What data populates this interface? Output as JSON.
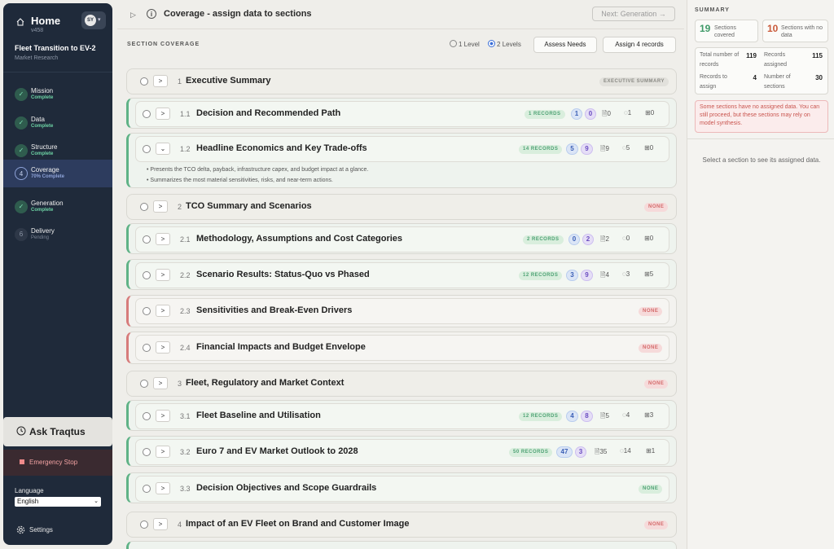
{
  "sidebar": {
    "home_title": "Home",
    "version": "v458",
    "avatar": "SY",
    "project_name": "Fleet Transition to EV-2",
    "project_sub": "Market Research",
    "steps": [
      {
        "label": "Mission",
        "status": "Complete"
      },
      {
        "label": "Data",
        "status": "Complete"
      },
      {
        "label": "Structure",
        "status": "Complete"
      },
      {
        "label": "Coverage",
        "status": "70% Complete",
        "num": "4"
      },
      {
        "label": "Generation",
        "status": "Complete"
      },
      {
        "label": "Delivery",
        "status": "Pending",
        "num": "6"
      }
    ],
    "ask_label": "Ask Traqtus",
    "emergency_label": "Emergency Stop",
    "language_label": "Language",
    "language_value": "English",
    "settings_label": "Settings"
  },
  "topbar": {
    "title": "Coverage - assign data to sections",
    "next_label": "Next: Generation →"
  },
  "coverage": {
    "heading": "SECTION COVERAGE",
    "level1": "1 Level",
    "level2": "2 Levels",
    "assess_label": "Assess Needs",
    "assign_label": "Assign 4 records"
  },
  "sections": [
    {
      "num": "1",
      "title": "Executive Summary",
      "pill": "EXECUTIVE SUMMARY"
    },
    {
      "num": "1.1",
      "title": "Decision and Recommended Path",
      "pill": "1 RECORDS",
      "c1": "1",
      "c2": "0",
      "docs": "0",
      "comments": "1",
      "tables": "0"
    },
    {
      "num": "1.2",
      "title": "Headline Economics and Key Trade-offs",
      "pill": "14 RECORDS",
      "c1": "5",
      "c2": "9",
      "docs": "9",
      "comments": "5",
      "tables": "0",
      "bullets": [
        "Presents the TCO delta, payback, infrastructure capex, and budget impact at a glance.",
        "Summarizes the most material sensitivities, risks, and near-term actions."
      ]
    },
    {
      "num": "2",
      "title": "TCO Summary and Scenarios",
      "pill": "NONE"
    },
    {
      "num": "2.1",
      "title": "Methodology, Assumptions and Cost Categories",
      "pill": "2 RECORDS",
      "c1": "0",
      "c2": "2",
      "docs": "2",
      "comments": "0",
      "tables": "0"
    },
    {
      "num": "2.2",
      "title": "Scenario Results: Status-Quo vs Phased",
      "pill": "12 RECORDS",
      "c1": "3",
      "c2": "9",
      "docs": "4",
      "comments": "3",
      "tables": "5"
    },
    {
      "num": "2.3",
      "title": "Sensitivities and Break-Even Drivers",
      "pill": "NONE"
    },
    {
      "num": "2.4",
      "title": "Financial Impacts and Budget Envelope",
      "pill": "NONE"
    },
    {
      "num": "3",
      "title": "Fleet, Regulatory and Market Context",
      "pill": "NONE"
    },
    {
      "num": "3.1",
      "title": "Fleet Baseline and Utilisation",
      "pill": "12 RECORDS",
      "c1": "4",
      "c2": "8",
      "docs": "5",
      "comments": "4",
      "tables": "3"
    },
    {
      "num": "3.2",
      "title": "Euro 7 and EV Market Outlook to 2028",
      "pill": "50 RECORDS",
      "c1": "47",
      "c2": "3",
      "docs": "35",
      "comments": "14",
      "tables": "1"
    },
    {
      "num": "3.3",
      "title": "Decision Objectives and Scope Guardrails",
      "pill": "NONE"
    },
    {
      "num": "4",
      "title": "Impact of an EV Fleet on Brand and Customer Image",
      "pill": "NONE"
    }
  ],
  "summary": {
    "title": "SUMMARY",
    "covered_num": "19",
    "covered_label": "Sections covered",
    "nodata_num": "10",
    "nodata_label": "Sections with no data",
    "total_label": "Total number of records",
    "total_val": "119",
    "assigned_label": "Records assigned",
    "assigned_val": "115",
    "toassign_label": "Records to assign",
    "toassign_val": "4",
    "numsec_label": "Number of sections",
    "numsec_val": "30",
    "warning": "Some sections have no assigned data. You can still proceed, but these sections may rely on model synthesis.",
    "empty": "Select a section to see its assigned data."
  },
  "colors": {
    "sidebar": "#1f2a3a",
    "green": "#5fb286",
    "red": "#d77b7b",
    "accent": "#3b6fd8"
  }
}
